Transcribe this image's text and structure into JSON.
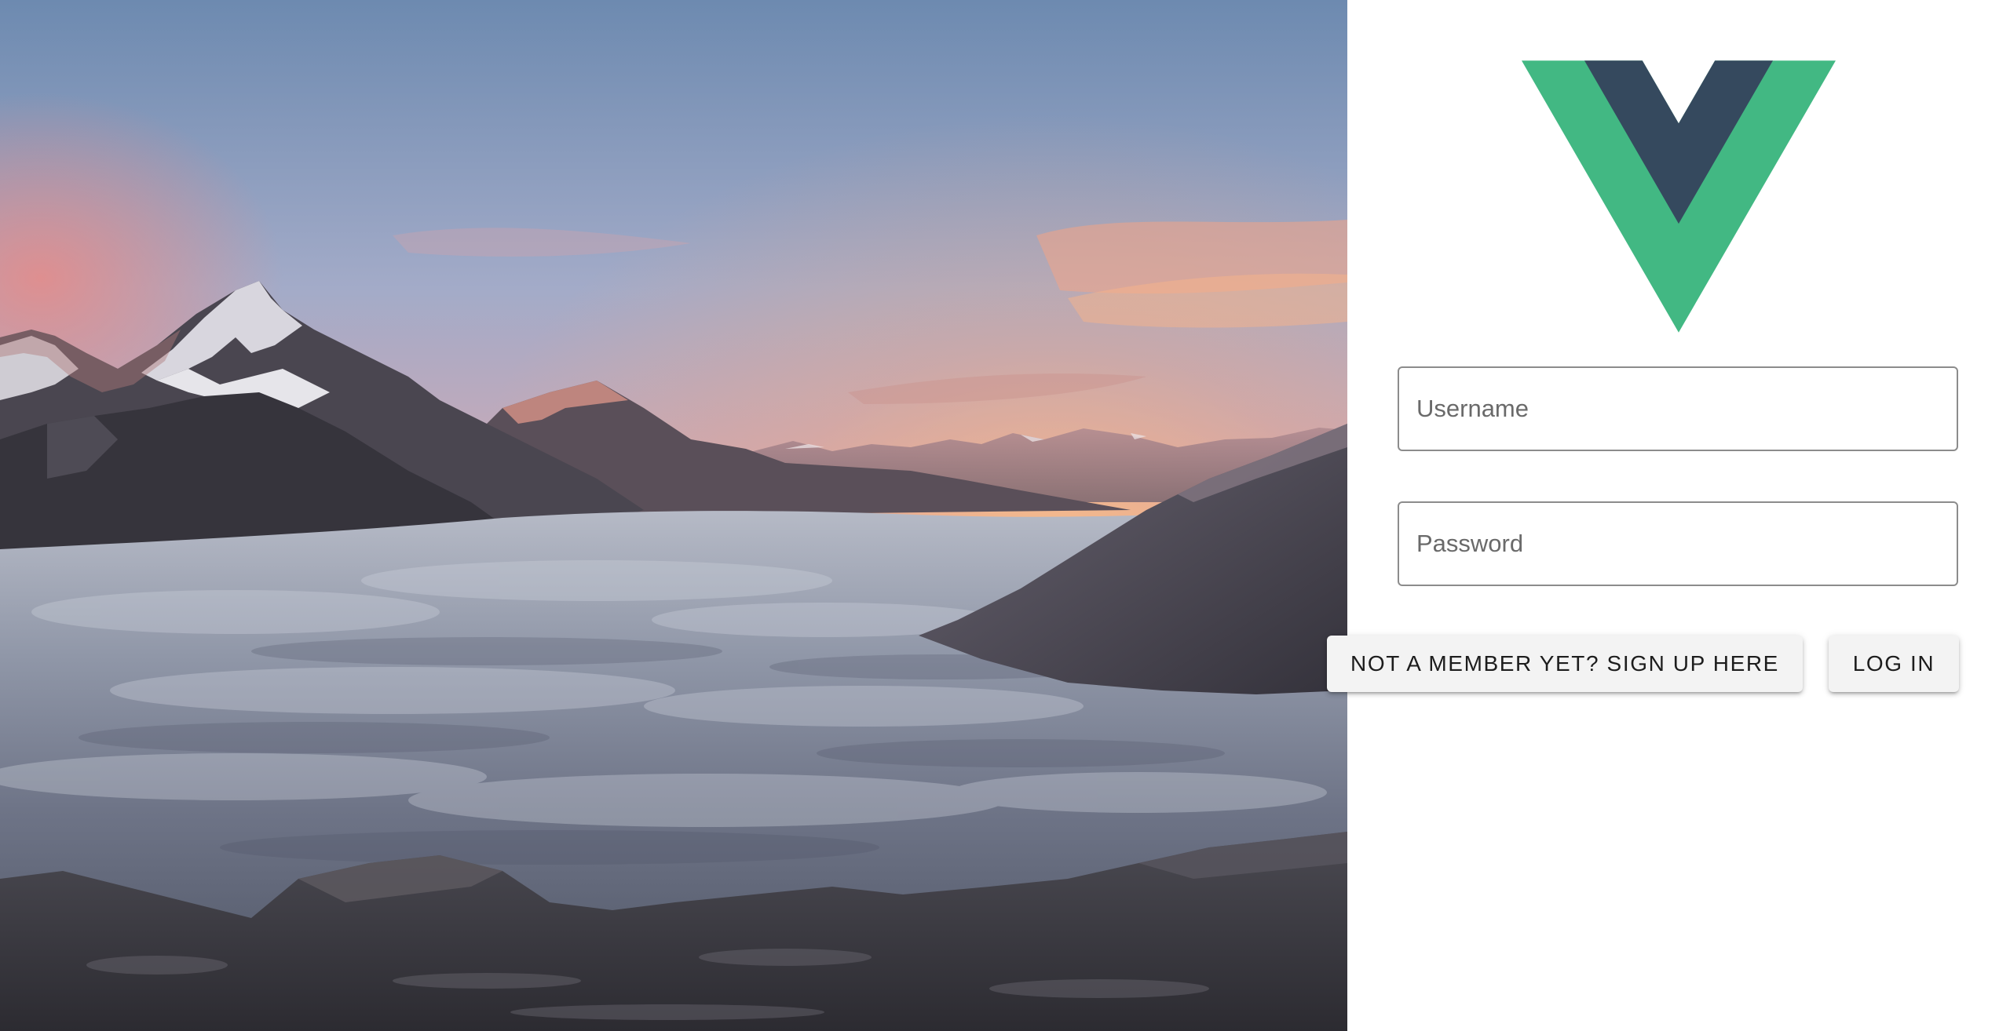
{
  "hero": {
    "image": "mountain-sunset-sea-of-clouds"
  },
  "logo": {
    "icon": "vue-logo-icon",
    "colors": {
      "outer": "#42b883",
      "inner": "#35495e"
    }
  },
  "form": {
    "username": {
      "placeholder": "Username",
      "value": ""
    },
    "password": {
      "placeholder": "Password",
      "value": ""
    },
    "signup_label": "NOT A MEMBER YET? SIGN UP HERE",
    "login_label": "LOG IN"
  },
  "colors": {
    "panel_background": "#ffffff",
    "button_background": "#f3f3f3",
    "field_border": "#8c8c8c"
  }
}
